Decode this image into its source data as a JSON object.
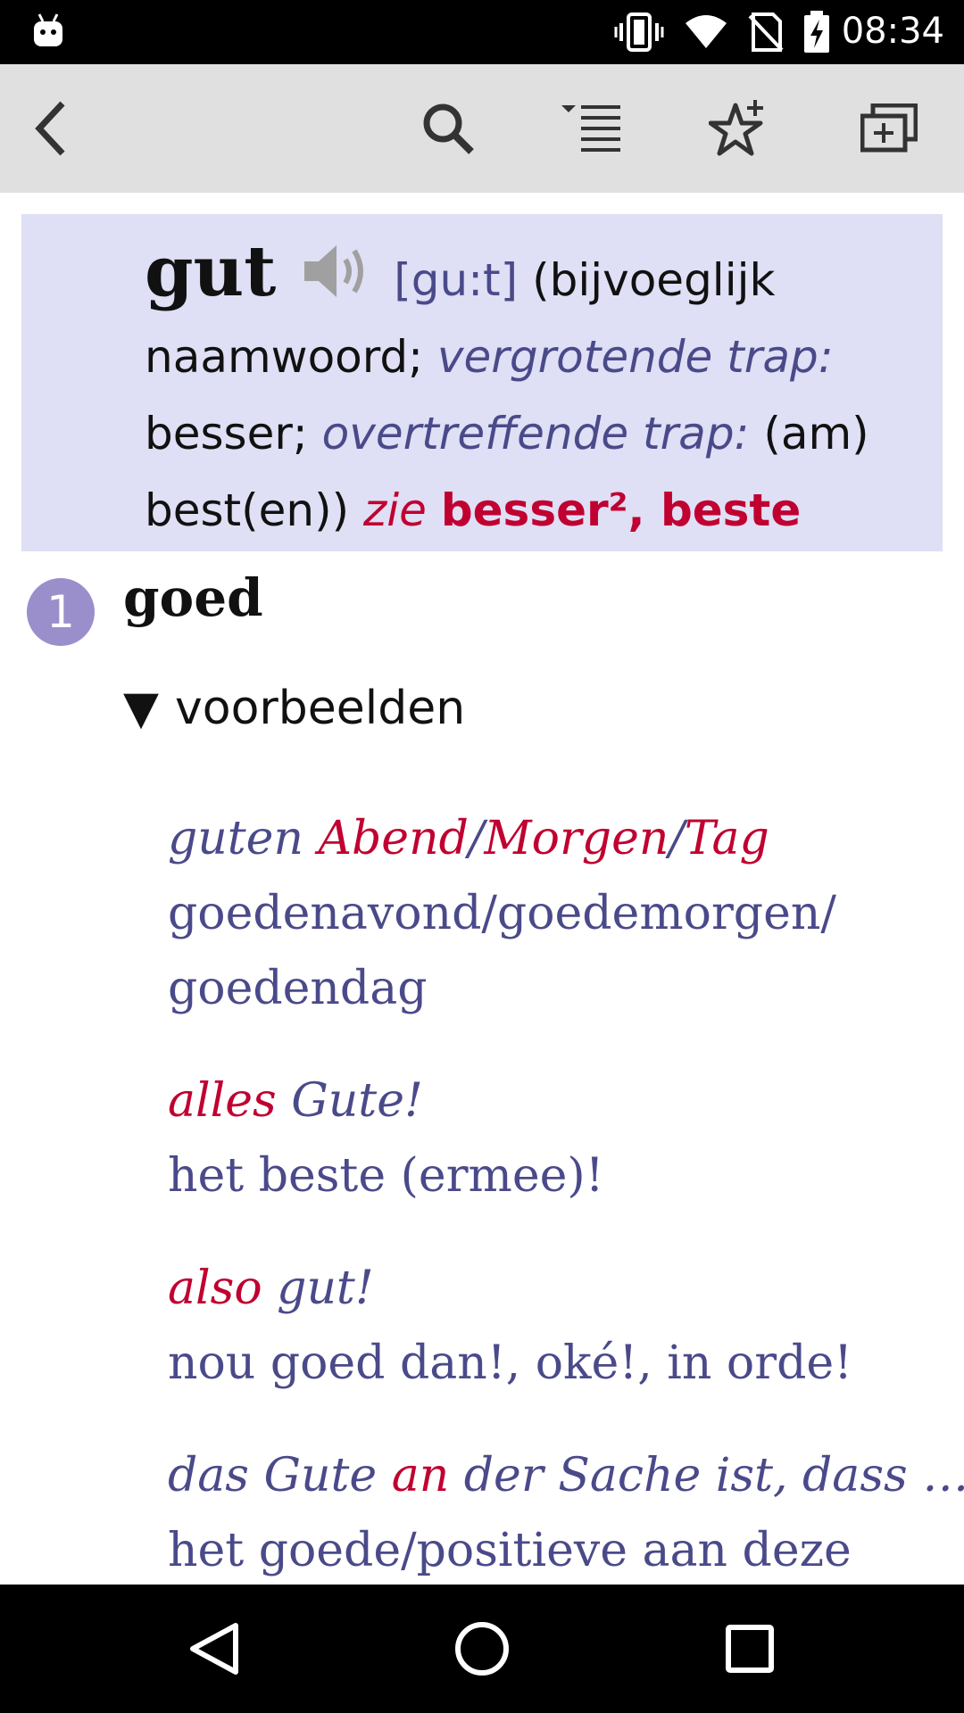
{
  "status_bar": {
    "time": "08:34",
    "icons": [
      "android-icon",
      "vibrate-icon",
      "wifi-icon",
      "no-sim-icon",
      "battery-charging-icon"
    ]
  },
  "toolbar": {
    "icons": [
      "back-icon",
      "search-icon",
      "list-icon",
      "favorite-add-icon",
      "new-window-icon"
    ]
  },
  "entry": {
    "headword": "gut",
    "phonetic": "[gu:t]",
    "pos_open": "(bijvoeglijk naamwoord;",
    "comparative_label": "vergrotende trap:",
    "comparative": "besser;",
    "superlative_label": "overtreffende trap:",
    "superlative": "(am) best(en))",
    "see_label": "zie",
    "see_targets": "besser², beste"
  },
  "sense": {
    "number": "1",
    "translation": "goed",
    "examples_label": "voorbeelden"
  },
  "examples": [
    {
      "parts": [
        {
          "text": "guten ",
          "color": "blue"
        },
        {
          "text": "Abend",
          "color": "red"
        },
        {
          "text": "/",
          "color": "blue"
        },
        {
          "text": "Morgen",
          "color": "red"
        },
        {
          "text": "/",
          "color": "blue"
        },
        {
          "text": "Tag",
          "color": "red"
        }
      ],
      "translation": "goedenavond/goedemorgen/ goedendag"
    },
    {
      "parts": [
        {
          "text": "alles",
          "color": "red"
        },
        {
          "text": " Gute!",
          "color": "blue"
        }
      ],
      "translation": "het beste (ermee)!"
    },
    {
      "parts": [
        {
          "text": "also",
          "color": "red"
        },
        {
          "text": " gut!",
          "color": "blue"
        }
      ],
      "translation": "nou goed dan!, oké!, in orde!"
    },
    {
      "parts": [
        {
          "text": "das Gute ",
          "color": "blue"
        },
        {
          "text": "an",
          "color": "red"
        },
        {
          "text": " der Sache ist, dass …",
          "color": "blue"
        }
      ],
      "translation": "het goede/positieve aan deze"
    }
  ],
  "colors": {
    "headword_bg": "#dfdff5",
    "accent_red": "#c00030",
    "translation_blue": "#4a4a8a",
    "badge": "#9a8fcb",
    "toolbar_bg": "#e0e0e0"
  },
  "nav_bar": {
    "icons": [
      "back-triangle-icon",
      "home-circle-icon",
      "recents-square-icon"
    ]
  }
}
